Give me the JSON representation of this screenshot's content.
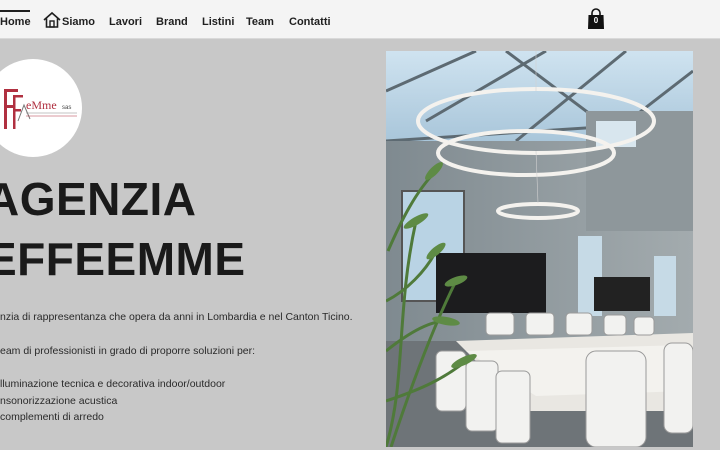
{
  "nav": {
    "items": [
      {
        "label": "Home",
        "active": true
      },
      {
        "label": "Siamo",
        "active": false
      },
      {
        "label": "Lavori",
        "active": false
      },
      {
        "label": "Brand",
        "active": false
      },
      {
        "label": "Listini",
        "active": false
      },
      {
        "label": "Team",
        "active": false
      },
      {
        "label": "Contatti",
        "active": false
      }
    ],
    "cart_count": "0"
  },
  "logo": {
    "text_main": "eMme",
    "text_suffix": "sas"
  },
  "hero": {
    "title_line1": "AGENZIA",
    "title_line2": "EFFEEMME",
    "intro": "nzia di rappresentanza che opera da anni in Lombardia e nel Canton Ticino.",
    "team_line": "eam di professionisti in grado di proporre soluzioni per:",
    "services": [
      "lluminazione tecnica e decorativa indoor/outdoor",
      "nsonorizzazione acustica",
      "complementi di arredo"
    ]
  },
  "colors": {
    "page_bg": "#c8c8c8",
    "nav_bg": "#f4f4f4",
    "text": "#1a1a1a",
    "logo_accent": "#b03040"
  }
}
